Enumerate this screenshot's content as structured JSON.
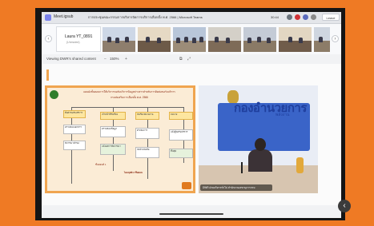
{
  "header": {
    "location": "Meet.igsub",
    "title": "การประชุมคณะกรรมการบริหารจัดการบริการเลือกตั้ง พ.ศ. 2566 | Microsoft Teams",
    "time": "30:44",
    "leave_label": "Leave"
  },
  "participants": {
    "featured_name": "Laura YT_0891",
    "featured_sub": "(Unmuted)"
  },
  "controls": {
    "view_label": "Viewing DWR's shared content",
    "zoom": "150%"
  },
  "slide": {
    "title_line1": "แผนผังขั้นตอนการให้บริการขอรับบริการข้อมูลข่าวสารสำหรับการติดต่อขอรับบริการ",
    "title_line2": "กรมส่งเสริมการเลือกตั้ง พ.ศ. 2566",
    "boxes": [
      "ยื่นคำขอรับบริการ",
      "ตรวจสอบเอกสาร",
      "พิจารณาคำขอ",
      "เจ้าหน้าที่รับเรื่อง",
      "ตรวจสอบข้อมูล",
      "แจ้งผลการพิจารณา",
      "ส่งเรื่องหน่วยงาน",
      "ดำเนินการ",
      "จัดทำหนังสือ",
      "ลงนาม",
      "แจ้งผู้ขอรับบริการ",
      "สิ้นสุด"
    ],
    "highlight_label": "ไม่อนุมัติ 3 ขั้นตอน",
    "step_label": "ขั้นตอนที่ 1"
  },
  "video": {
    "logo_text": "กองอำนวยการ",
    "logo_sub": "พลังงาน",
    "speaker_caption": "DWR ฝ่ายบริหารทั่วไป  สำนักงานเลขานุการกรม"
  },
  "colors": {
    "frame": "#ef7a24",
    "slide_border": "#f0a550",
    "slide_bg": "#fbecd6",
    "accent_blue": "#3a64c8"
  }
}
